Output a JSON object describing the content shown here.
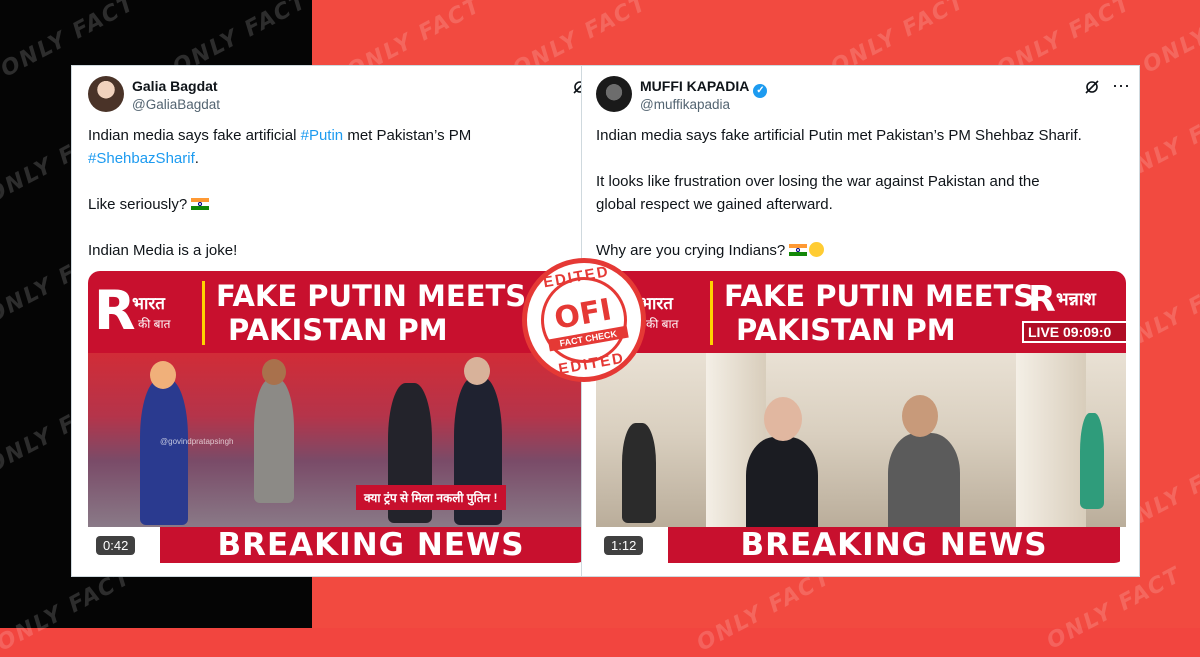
{
  "watermark": "ONLY FACT",
  "left_tweet": {
    "name": "Galia Bagdat",
    "handle": "@GaliaBagdat",
    "text": {
      "l1_a": "Indian media says fake artificial ",
      "l1_tag": "#Putin",
      "l1_b": " met Pakistan’s PM",
      "l2_tag": "#ShehbazSharif",
      "l2_b": ".",
      "l3": "Like seriously?",
      "l4": "Indian Media is a joke!"
    },
    "video": {
      "logo_r": "R",
      "logo_line1": "भारत",
      "logo_line2": "की बात",
      "headline_1": "FAKE PUTIN MEETS",
      "headline_2": "PAKISTAN PM",
      "caption_watermark": "@govindpratapsingh",
      "lower_third": "क्या ट्रंप से मिला नकली पुतिन !",
      "breaking": "BREAKING NEWS",
      "duration": "0:42"
    }
  },
  "right_tweet": {
    "name": "MUFFI KAPADIA",
    "handle": "@muffikapadia",
    "text": {
      "p1": "Indian media says fake artificial Putin met Pakistan’s PM Shehbaz Sharif.",
      "p2_l1": "It looks like frustration over losing the war against Pakistan and the",
      "p2_l2": "global respect we gained afterward.",
      "p3": "Why are you crying Indians?"
    },
    "video": {
      "logo_r": "R",
      "logo_line1": "भारत",
      "logo_line2": "की बात",
      "headline_1": "FAKE PUTIN MEETS",
      "headline_2": "PAKISTAN PM",
      "live_r": "R",
      "live_name": "भन्नाश",
      "live_clock": "LIVE 09:09:0",
      "breaking": "BREAKING NEWS",
      "duration": "1:12"
    }
  },
  "stamp": {
    "top": "EDITED",
    "logo": "OFI",
    "sub": "FACT CHECK",
    "bottom": "EDITED"
  },
  "colors": {
    "background_red": "#f24a40",
    "background_black": "#050505",
    "news_red": "#c8102e",
    "link_blue": "#1d9bf0",
    "stamp_red": "#e53935"
  },
  "icons": [
    "grok-icon",
    "verified-badge-icon",
    "india-flag-icon",
    "laughing-face-icon"
  ]
}
